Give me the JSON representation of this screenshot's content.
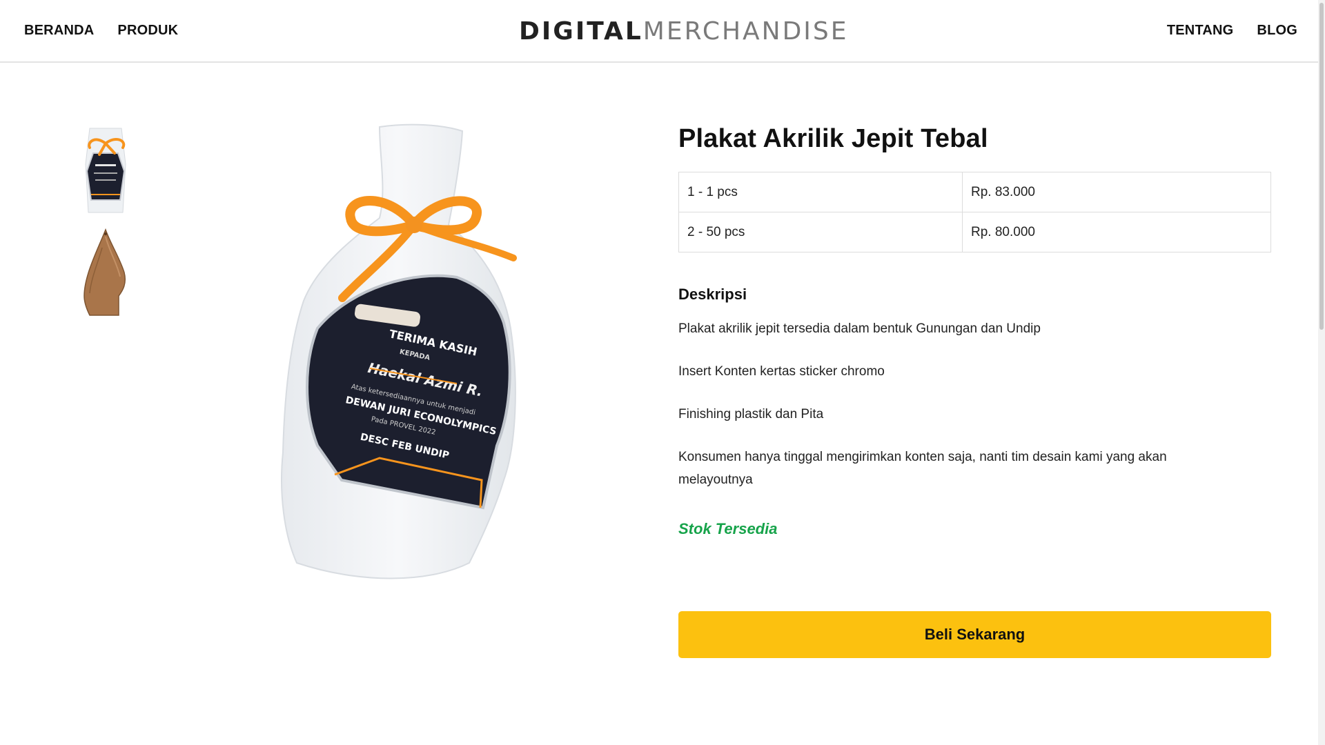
{
  "header": {
    "nav_left": [
      "BERANDA",
      "PRODUK"
    ],
    "logo_bold": "DIGITAL",
    "logo_light": "MERCHANDISE",
    "nav_right": [
      "TENTANG",
      "BLOG"
    ]
  },
  "product": {
    "title": "Plakat Akrilik Jepit Tebal",
    "prices": [
      {
        "qty": "1 - 1 pcs",
        "price": "Rp. 83.000"
      },
      {
        "qty": "2 - 50 pcs",
        "price": "Rp. 80.000"
      }
    ],
    "description_heading": "Deskripsi",
    "description": [
      "Plakat akrilik jepit tersedia dalam bentuk Gunungan dan Undip",
      "Insert Konten kertas sticker chromo",
      "Finishing plastik dan Pita",
      "Konsumen hanya tinggal mengirimkan konten saja, nanti tim desain kami yang akan melayoutnya"
    ],
    "stock_status": "Stok Tersedia",
    "buy_label": "Beli Sekarang",
    "plaque_text": {
      "line1": "TERIMA KASIH",
      "line2": "KEPADA",
      "line3": "Haekal Azmi R.",
      "line4": "Atas ketersediaannya untuk menjadi",
      "line5": "DEWAN JURI ECONOLYMPICS",
      "line6": "Pada PROVEL 2022",
      "line7": "DESC FEB UNDIP"
    }
  },
  "colors": {
    "accent_button": "#fcc10f",
    "stock_green": "#16a34a",
    "ribbon_orange": "#f7941d",
    "plaque_dark": "#1c1f2e"
  },
  "icons": {
    "thumbnail_1": "plaque-wrapped-image",
    "thumbnail_2": "wooden-gunungan-image"
  }
}
